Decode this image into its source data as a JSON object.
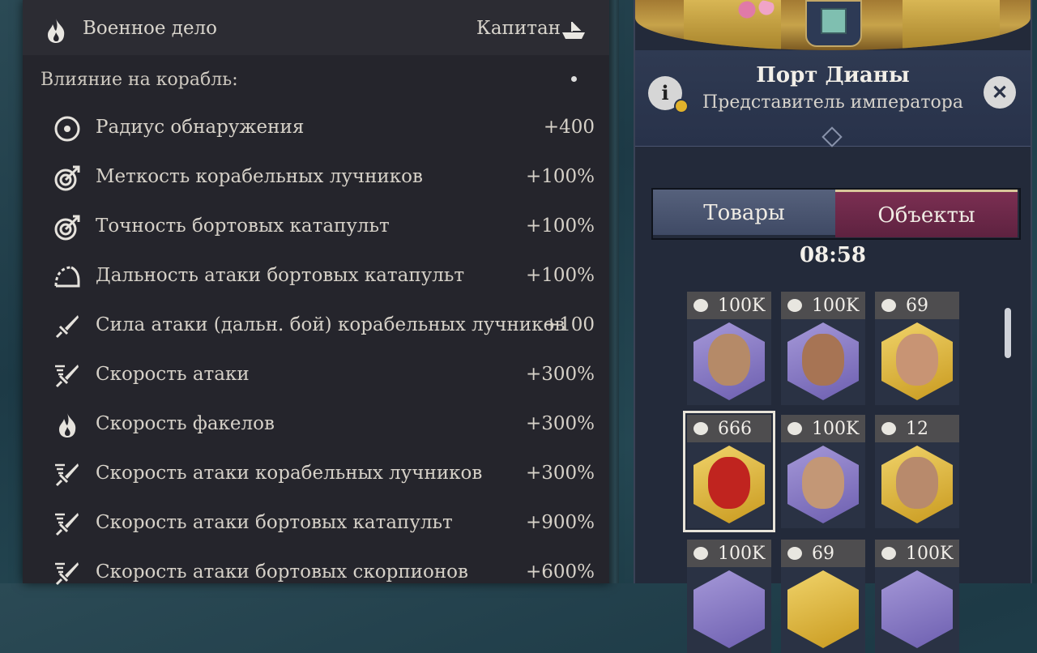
{
  "tooltip": {
    "header": {
      "title": "Военное дело",
      "rank": "Капитан"
    },
    "section_label": "Влияние на корабль:",
    "stats": [
      {
        "icon": "target-icon",
        "label": "Радиус обнаружения",
        "value": "+400"
      },
      {
        "icon": "bullseye-arrow-icon",
        "label": "Меткость корабельных лучников",
        "value": "+100%"
      },
      {
        "icon": "bullseye-arrow-icon",
        "label": "Точность бортовых катапульт",
        "value": "+100%"
      },
      {
        "icon": "range-arc-icon",
        "label": "Дальность атаки бортовых катапульт",
        "value": "+100%"
      },
      {
        "icon": "sword-icon",
        "label": "Сила атаки (дальн. бой) корабельных лучников",
        "value": "+100"
      },
      {
        "icon": "fast-sword-icon",
        "label": "Скорость атаки",
        "value": "+300%"
      },
      {
        "icon": "flame-icon",
        "label": "Скорость факелов",
        "value": "+300%"
      },
      {
        "icon": "fast-sword-icon",
        "label": "Скорость атаки корабельных лучников",
        "value": "+300%"
      },
      {
        "icon": "fast-sword-icon",
        "label": "Скорость атаки бортовых катапульт",
        "value": "+900%"
      },
      {
        "icon": "fast-sword-icon",
        "label": "Скорость атаки бортовых скорпионов",
        "value": "+600%"
      }
    ]
  },
  "port": {
    "title": "Порт Дианы",
    "subtitle": "Представитель императора",
    "info_label": "i",
    "close_label": "✕",
    "tabs": [
      {
        "label": "Товары"
      },
      {
        "label": "Объекты"
      }
    ],
    "active_tab": "Объекты",
    "timer": "08:58",
    "items": [
      {
        "price": "100K",
        "rarity": "purple",
        "skin": "#b58a68"
      },
      {
        "price": "100K",
        "rarity": "purple",
        "skin": "#a77454"
      },
      {
        "price": "69",
        "rarity": "gold",
        "skin": "#c89474"
      },
      {
        "price": "666",
        "rarity": "gold",
        "skin": "#c0241f",
        "selected": true
      },
      {
        "price": "100K",
        "rarity": "purple",
        "skin": "#c39776"
      },
      {
        "price": "12",
        "rarity": "gold",
        "skin": "#b88a6c"
      },
      {
        "price": "100K",
        "rarity": "purple",
        "skin": "#b07a56"
      },
      {
        "price": "69",
        "rarity": "gold",
        "skin": "#ba8f6e"
      },
      {
        "price": "100K",
        "rarity": "purple",
        "skin": "#b1866a"
      }
    ]
  }
}
